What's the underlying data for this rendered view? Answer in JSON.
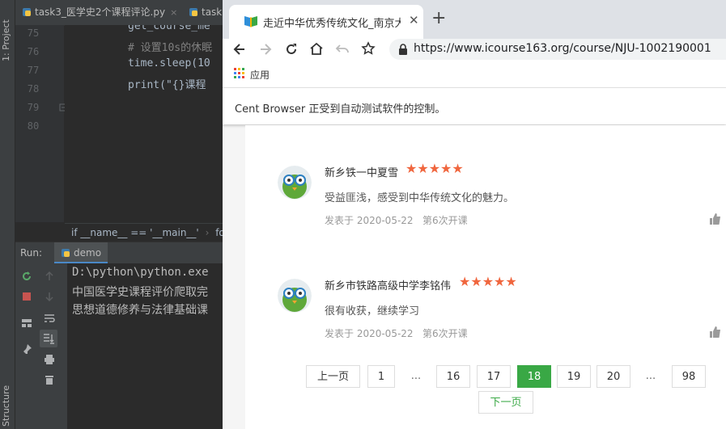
{
  "ide": {
    "sidebar_tabs": {
      "project": "1: Project",
      "structure": "Structure"
    },
    "editor_tabs": [
      {
        "label": "task3_医学史2个课程评论.py",
        "close": "×"
      },
      {
        "label": "task"
      }
    ],
    "line_numbers": [
      "75",
      "76",
      "77",
      "78",
      "79",
      "80"
    ],
    "code_lines": [
      {
        "text": "get_course_me",
        "color": "#a9b7c6"
      },
      {
        "text": "# 设置10s的休眠",
        "color": "#808080"
      },
      {
        "text": "time.sleep(10",
        "color": "#a9b7c6"
      },
      {
        "text": "print(\"{}课程",
        "color": "#a9b7c6"
      }
    ],
    "breadcrumb": [
      "if __name__ == '__main__'",
      "for"
    ],
    "run": {
      "label": "Run:",
      "tab": "demo",
      "console_lines": [
        "D:\\python\\python.exe",
        "中国医学史课程评价爬取完",
        "思想道德修养与法律基础课"
      ]
    }
  },
  "browser": {
    "tab_title": "走近中华优秀传统文化_南京大学",
    "tab_close": "✕",
    "new_tab": "+",
    "url": "https://www.icourse163.org/course/NJU-1002190001",
    "bookmark_apps": "应用",
    "infobar": "Cent Browser 正受到自动测试软件的控制。"
  },
  "reviews": [
    {
      "name": "新乡铁一中夏雪",
      "stars": 5,
      "text": "受益匪浅，感受到中华传统文化的魅力。",
      "date": "发表于 2020-05-22",
      "session": "第6次开课"
    },
    {
      "name": "新乡市铁路高级中学李铭伟",
      "stars": 5,
      "text": "很有收获，继续学习",
      "date": "发表于 2020-05-22",
      "session": "第6次开课"
    }
  ],
  "pagination": {
    "prev": "上一页",
    "pages": [
      "1",
      "...",
      "16",
      "17",
      "18",
      "19",
      "20",
      "...",
      "98"
    ],
    "current": "18",
    "next": "下一页"
  },
  "colors": {
    "accent_green": "#39a845",
    "star_orange": "#f0663e"
  }
}
